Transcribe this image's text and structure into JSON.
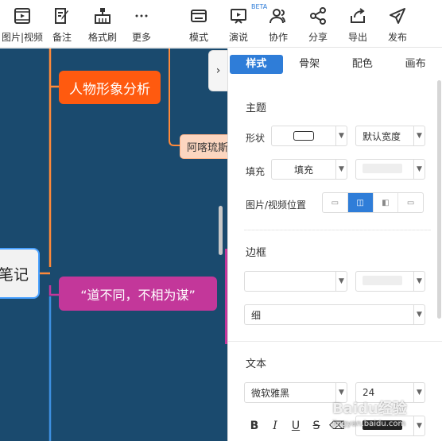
{
  "toolbar": {
    "items": [
      {
        "label": "图片|视频",
        "icon": "film-icon"
      },
      {
        "label": "备注",
        "icon": "note-icon"
      },
      {
        "label": "格式刷",
        "icon": "format-brush-icon"
      },
      {
        "label": "更多",
        "icon": "more-icon"
      },
      {
        "label": "模式",
        "icon": "mode-icon"
      },
      {
        "label": "演说",
        "icon": "presentation-icon",
        "badge": "BETA"
      },
      {
        "label": "协作",
        "icon": "collaborate-icon"
      },
      {
        "label": "分享",
        "icon": "share-icon"
      },
      {
        "label": "导出",
        "icon": "export-icon"
      },
      {
        "label": "发布",
        "icon": "publish-icon"
      }
    ]
  },
  "canvas": {
    "nodes": {
      "n1": "人物形象分析",
      "n2": "阿喀琉斯",
      "n3": "笔记",
      "n4": "“道不同，不相为谋”"
    },
    "colors": {
      "background": "#1a4a6e",
      "orange": "#ff5a0f",
      "magenta": "#c3379a",
      "peach": "#fcd6c0"
    }
  },
  "panel": {
    "tabs": [
      "样式",
      "骨架",
      "配色",
      "画布"
    ],
    "active_tab": "样式",
    "theme": {
      "title": "主题",
      "shape_label": "形状",
      "width_value": "默认宽度",
      "fill_label": "填充",
      "fill_value": "填充",
      "media_label": "图片/视频位置"
    },
    "border": {
      "title": "边框",
      "thickness_value": "细"
    },
    "text": {
      "title": "文本",
      "font_value": "微软雅黑",
      "size_value": "24"
    },
    "accent": "#2f7dd8"
  },
  "watermark": "Baidu经验",
  "watermark_url": "jingyan.baidu.com"
}
